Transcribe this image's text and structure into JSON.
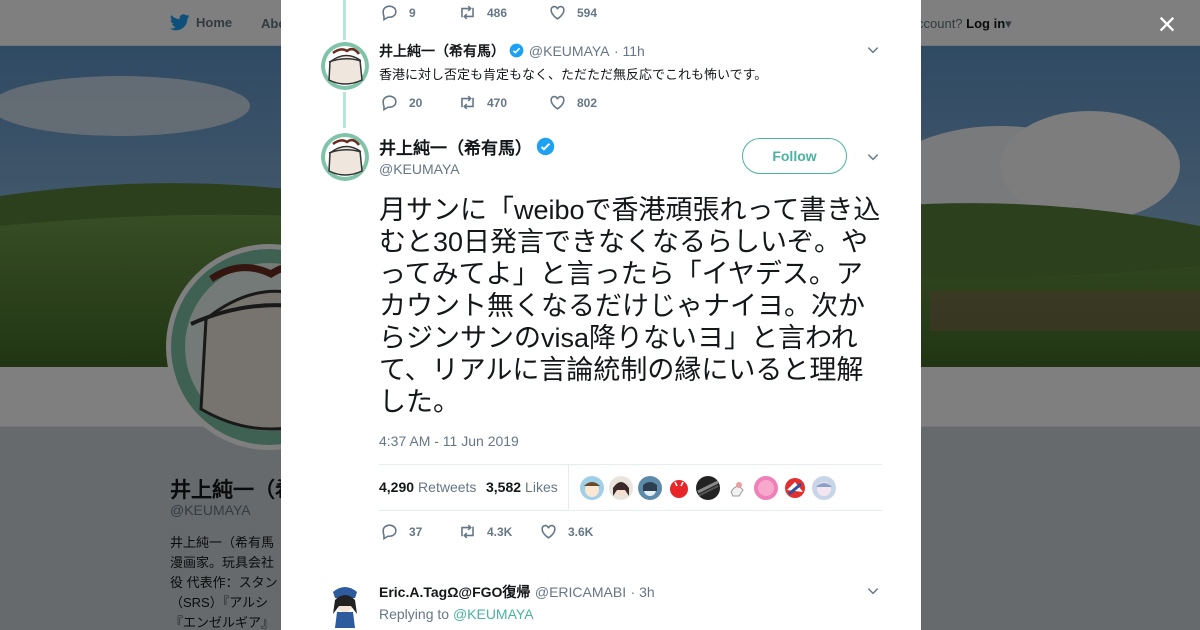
{
  "nav": {
    "home_label": "Home",
    "about_label": "Abo",
    "account_prefix": "ccount?",
    "login_label": "Log in"
  },
  "profile": {
    "name": "井上純一（希",
    "handle": "@KEUMAYA",
    "bio_lines": [
      "井上純一（希有馬",
      "漫画家。玩具会社",
      "役 代表作：スタン",
      "（SRS）『アルシ",
      "『エンゼルギア』"
    ]
  },
  "close_label": "×",
  "colors": {
    "accent": "#4ab3a0",
    "verified": "#1da1f2",
    "thread": "#b8e5d9"
  },
  "prev_tweet": {
    "actions": {
      "replies": "9",
      "retweets": "486",
      "likes": "594"
    }
  },
  "tweet1": {
    "name": "井上純一（希有馬）",
    "handle": "@KEUMAYA",
    "time": "· 11h",
    "text": "香港に対し否定も肯定もなく、ただただ無反応でこれも怖いです。",
    "actions": {
      "replies": "20",
      "retweets": "470",
      "likes": "802"
    }
  },
  "main_tweet": {
    "name": "井上純一（希有馬）",
    "handle": "@KEUMAYA",
    "follow_label": "Follow",
    "text": "月サンに「weiboで香港頑張れって書き込むと30日発言できなくなるらしいぞ。やってみてよ」と言ったら「イヤデス。アカウント無くなるだけじゃナイヨ。次からジンサンのvisa降りないヨ」と言われて、リアルに言論統制の縁にいると理解した。",
    "timestamp": "4:37 AM - 11 Jun 2019",
    "retweets_count": "4,290",
    "retweets_label": "Retweets",
    "likes_count": "3,582",
    "likes_label": "Likes",
    "actions": {
      "replies": "37",
      "retweets": "4.3K",
      "likes": "3.6K"
    }
  },
  "reply": {
    "name": "Eric.A.TagΩ@FGO復帰",
    "handle": "@ERICAMABI",
    "time": "· 3h",
    "replying_prefix": "Replying to",
    "replying_to": "@KEUMAYA"
  }
}
